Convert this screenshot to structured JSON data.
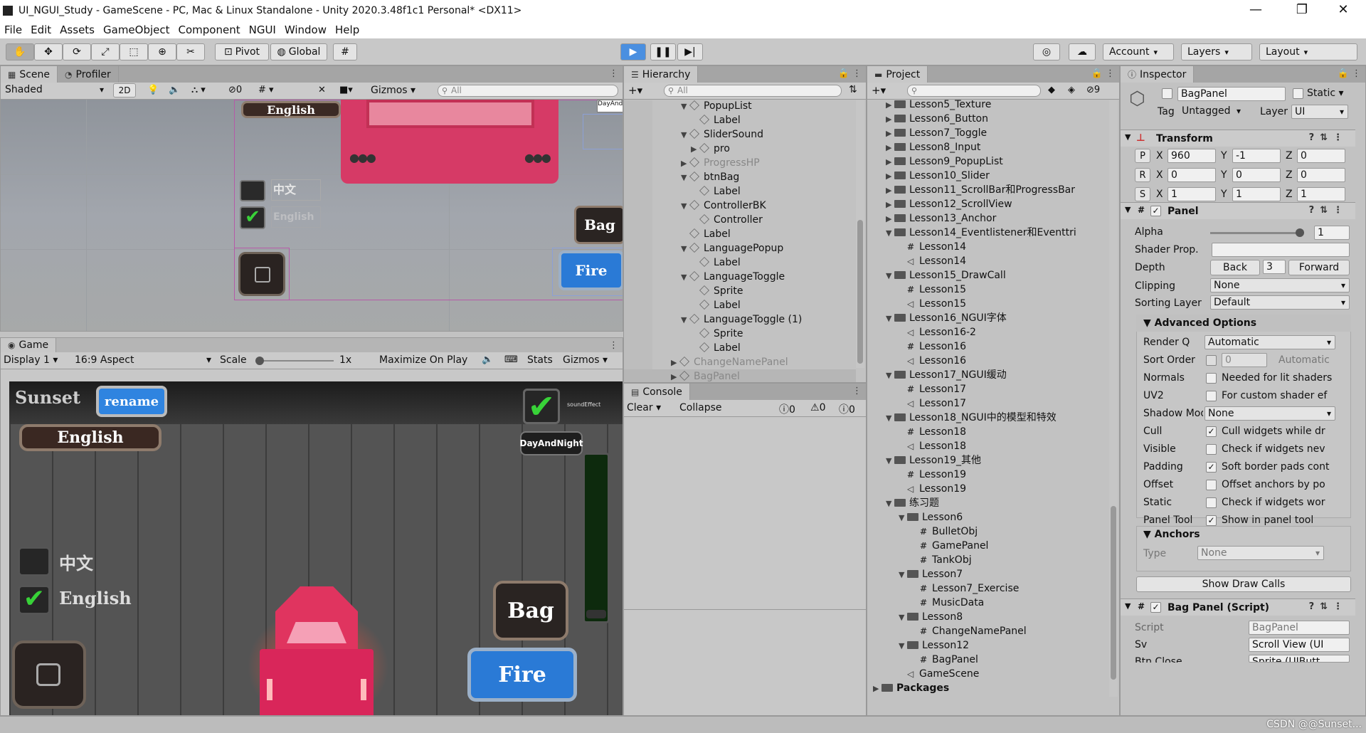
{
  "window": {
    "title": "UI_NGUI_Study - GameScene - PC, Mac & Linux Standalone - Unity 2020.3.48f1c1 Personal* <DX11>"
  },
  "menu": [
    "File",
    "Edit",
    "Assets",
    "GameObject",
    "Component",
    "NGUI",
    "Window",
    "Help"
  ],
  "toolbar": {
    "pivot": "Pivot",
    "global": "Global",
    "account": "Account",
    "layers": "Layers",
    "layout": "Layout"
  },
  "scene": {
    "tab": "Scene",
    "profiler_tab": "Profiler",
    "shading": "Shaded",
    "mode2d": "2D",
    "hidden_count": "0",
    "gizmos": "Gizmos",
    "search_placeholder": "All",
    "labels": {
      "english": "English",
      "chinese": "中文",
      "english_faded": "English",
      "bag": "Bag",
      "fire": "Fire",
      "dayand": "DayAnd"
    }
  },
  "game": {
    "tab": "Game",
    "display": "Display 1",
    "aspect": "16:9 Aspect",
    "scale_label": "Scale",
    "scale_value": "1x",
    "maximize": "Maximize On Play",
    "stats": "Stats",
    "gizmos": "Gizmos",
    "labels": {
      "sunset": "Sunset",
      "rename": "rename",
      "english": "English",
      "soundeffect": "soundEffect",
      "daynight": "DayAndNight",
      "chinese": "中文",
      "english_toggle": "English",
      "bag": "Bag",
      "fire": "Fire"
    }
  },
  "hierarchy": {
    "tab": "Hierarchy",
    "search_placeholder": "All",
    "items": [
      {
        "label": "PopupList",
        "depth": 4,
        "tri": "▼",
        "icon": "cube"
      },
      {
        "label": "Label",
        "depth": 5,
        "tri": "",
        "icon": "cube"
      },
      {
        "label": "SliderSound",
        "depth": 4,
        "tri": "▼",
        "icon": "cube"
      },
      {
        "label": "pro",
        "depth": 5,
        "tri": "▶",
        "icon": "cube"
      },
      {
        "label": "ProgressHP",
        "depth": 4,
        "tri": "▶",
        "icon": "cube",
        "faded": true
      },
      {
        "label": "btnBag",
        "depth": 4,
        "tri": "▼",
        "icon": "cube"
      },
      {
        "label": "Label",
        "depth": 5,
        "tri": "",
        "icon": "cube"
      },
      {
        "label": "ControllerBK",
        "depth": 4,
        "tri": "▼",
        "icon": "cube"
      },
      {
        "label": "Controller",
        "depth": 5,
        "tri": "",
        "icon": "cube"
      },
      {
        "label": "Label",
        "depth": 4,
        "tri": "",
        "icon": "cube"
      },
      {
        "label": "LanguagePopup",
        "depth": 4,
        "tri": "▼",
        "icon": "cube"
      },
      {
        "label": "Label",
        "depth": 5,
        "tri": "",
        "icon": "cube"
      },
      {
        "label": "LanguageToggle",
        "depth": 4,
        "tri": "▼",
        "icon": "cube"
      },
      {
        "label": "Sprite",
        "depth": 5,
        "tri": "",
        "icon": "cube"
      },
      {
        "label": "Label",
        "depth": 5,
        "tri": "",
        "icon": "cube"
      },
      {
        "label": "LanguageToggle (1)",
        "depth": 4,
        "tri": "▼",
        "icon": "cube"
      },
      {
        "label": "Sprite",
        "depth": 5,
        "tri": "",
        "icon": "cube"
      },
      {
        "label": "Label",
        "depth": 5,
        "tri": "",
        "icon": "cube"
      },
      {
        "label": "ChangeNamePanel",
        "depth": 3,
        "tri": "▶",
        "icon": "cube",
        "faded": true
      },
      {
        "label": "BagPanel",
        "depth": 3,
        "tri": "▶",
        "icon": "cube",
        "faded": true,
        "selected": true
      }
    ]
  },
  "console": {
    "tab": "Console",
    "clear": "Clear",
    "collapse": "Collapse",
    "info_count": "0",
    "warn_count": "0",
    "error_count": "0"
  },
  "project": {
    "tab": "Project",
    "hidden_count": "9",
    "items": [
      {
        "label": "Lesson5_Texture",
        "depth": 1,
        "tri": "▶",
        "icon": "folder"
      },
      {
        "label": "Lesson6_Button",
        "depth": 1,
        "tri": "▶",
        "icon": "folder"
      },
      {
        "label": "Lesson7_Toggle",
        "depth": 1,
        "tri": "▶",
        "icon": "folder"
      },
      {
        "label": "Lesson8_Input",
        "depth": 1,
        "tri": "▶",
        "icon": "folder"
      },
      {
        "label": "Lesson9_PopupList",
        "depth": 1,
        "tri": "▶",
        "icon": "folder"
      },
      {
        "label": "Lesson10_Slider",
        "depth": 1,
        "tri": "▶",
        "icon": "folder"
      },
      {
        "label": "Lesson11_ScrollBar和ProgressBar",
        "depth": 1,
        "tri": "▶",
        "icon": "folder"
      },
      {
        "label": "Lesson12_ScrollView",
        "depth": 1,
        "tri": "▶",
        "icon": "folder"
      },
      {
        "label": "Lesson13_Anchor",
        "depth": 1,
        "tri": "▶",
        "icon": "folder"
      },
      {
        "label": "Lesson14_Eventlistener和Eventtri",
        "depth": 1,
        "tri": "▼",
        "icon": "folder"
      },
      {
        "label": "Lesson14",
        "depth": 2,
        "tri": "",
        "icon": "script"
      },
      {
        "label": "Lesson14",
        "depth": 2,
        "tri": "",
        "icon": "scene"
      },
      {
        "label": "Lesson15_DrawCall",
        "depth": 1,
        "tri": "▼",
        "icon": "folder"
      },
      {
        "label": "Lesson15",
        "depth": 2,
        "tri": "",
        "icon": "script"
      },
      {
        "label": "Lesson15",
        "depth": 2,
        "tri": "",
        "icon": "scene"
      },
      {
        "label": "Lesson16_NGUI字体",
        "depth": 1,
        "tri": "▼",
        "icon": "folder"
      },
      {
        "label": "Lesson16-2",
        "depth": 2,
        "tri": "",
        "icon": "scene"
      },
      {
        "label": "Lesson16",
        "depth": 2,
        "tri": "",
        "icon": "script"
      },
      {
        "label": "Lesson16",
        "depth": 2,
        "tri": "",
        "icon": "scene"
      },
      {
        "label": "Lesson17_NGUI缓动",
        "depth": 1,
        "tri": "▼",
        "icon": "folder"
      },
      {
        "label": "Lesson17",
        "depth": 2,
        "tri": "",
        "icon": "script"
      },
      {
        "label": "Lesson17",
        "depth": 2,
        "tri": "",
        "icon": "scene"
      },
      {
        "label": "Lesson18_NGUI中的模型和特效",
        "depth": 1,
        "tri": "▼",
        "icon": "folder"
      },
      {
        "label": "Lesson18",
        "depth": 2,
        "tri": "",
        "icon": "script"
      },
      {
        "label": "Lesson18",
        "depth": 2,
        "tri": "",
        "icon": "scene"
      },
      {
        "label": "Lesson19_其他",
        "depth": 1,
        "tri": "▼",
        "icon": "folder"
      },
      {
        "label": "Lesson19",
        "depth": 2,
        "tri": "",
        "icon": "script"
      },
      {
        "label": "Lesson19",
        "depth": 2,
        "tri": "",
        "icon": "scene"
      },
      {
        "label": "练习题",
        "depth": 1,
        "tri": "▼",
        "icon": "folder"
      },
      {
        "label": "Lesson6",
        "depth": 2,
        "tri": "▼",
        "icon": "folder"
      },
      {
        "label": "BulletObj",
        "depth": 3,
        "tri": "",
        "icon": "script"
      },
      {
        "label": "GamePanel",
        "depth": 3,
        "tri": "",
        "icon": "script"
      },
      {
        "label": "TankObj",
        "depth": 3,
        "tri": "",
        "icon": "script"
      },
      {
        "label": "Lesson7",
        "depth": 2,
        "tri": "▼",
        "icon": "folder"
      },
      {
        "label": "Lesson7_Exercise",
        "depth": 3,
        "tri": "",
        "icon": "script"
      },
      {
        "label": "MusicData",
        "depth": 3,
        "tri": "",
        "icon": "script"
      },
      {
        "label": "Lesson8",
        "depth": 2,
        "tri": "▼",
        "icon": "folder"
      },
      {
        "label": "ChangeNamePanel",
        "depth": 3,
        "tri": "",
        "icon": "script"
      },
      {
        "label": "Lesson12",
        "depth": 2,
        "tri": "▼",
        "icon": "folder"
      },
      {
        "label": "BagPanel",
        "depth": 3,
        "tri": "",
        "icon": "script"
      },
      {
        "label": "GameScene",
        "depth": 2,
        "tri": "",
        "icon": "scene"
      },
      {
        "label": "Packages",
        "depth": 0,
        "tri": "▶",
        "icon": "folder",
        "bold": true
      }
    ]
  },
  "inspector": {
    "tab": "Inspector",
    "object_name": "BagPanel",
    "static": "Static",
    "tag_label": "Tag",
    "tag": "Untagged",
    "layer_label": "Layer",
    "layer": "UI",
    "transform": {
      "title": "Transform",
      "p": "P",
      "r": "R",
      "s": "S",
      "x": "X",
      "y": "Y",
      "z": "Z",
      "px": "960",
      "py": "-1",
      "pz": "0",
      "rx": "0",
      "ry": "0",
      "rz": "0",
      "sx": "1",
      "sy": "1",
      "sz": "1"
    },
    "panel": {
      "title": "Panel",
      "alpha_label": "Alpha",
      "alpha": "1",
      "alpha_level": 1,
      "shader_label": "Shader Prop.",
      "depth_label": "Depth",
      "back": "Back",
      "depth": "3",
      "forward": "Forward",
      "clipping_label": "Clipping",
      "clipping": "None",
      "sorting_label": "Sorting Layer",
      "sorting": "Default"
    },
    "advanced": {
      "title": "Advanced Options",
      "render_q_label": "Render Q",
      "render_q": "Automatic",
      "sort_order_label": "Sort Order",
      "sort_order": "0",
      "sort_order_auto": "Automatic",
      "normals_label": "Normals",
      "normals_text": "Needed for lit shaders",
      "uv2_label": "UV2",
      "uv2_text": "For custom shader ef",
      "shadow_label": "Shadow Mode",
      "shadow": "None",
      "cull_label": "Cull",
      "cull_text": "Cull widgets while dr",
      "visible_label": "Visible",
      "visible_text": "Check if widgets nev",
      "padding_label": "Padding",
      "padding_text": "Soft border pads cont",
      "offset_label": "Offset",
      "offset_text": "Offset anchors by po",
      "static_label": "Static",
      "static_text": "Check if widgets wor",
      "paneltool_label": "Panel Tool",
      "paneltool_text": "Show in panel tool"
    },
    "anchors": {
      "title": "Anchors",
      "type_label": "Type",
      "type": "None"
    },
    "show_draw_calls": "Show Draw Calls",
    "bagpanel": {
      "title": "Bag Panel (Script)",
      "script_label": "Script",
      "script": "BagPanel",
      "sv_label": "Sv",
      "sv": "Scroll View (UI",
      "btn_label": "Btn Close",
      "btn": "Sprite (UIButt"
    }
  },
  "watermark": "CSDN @@Sunset..."
}
